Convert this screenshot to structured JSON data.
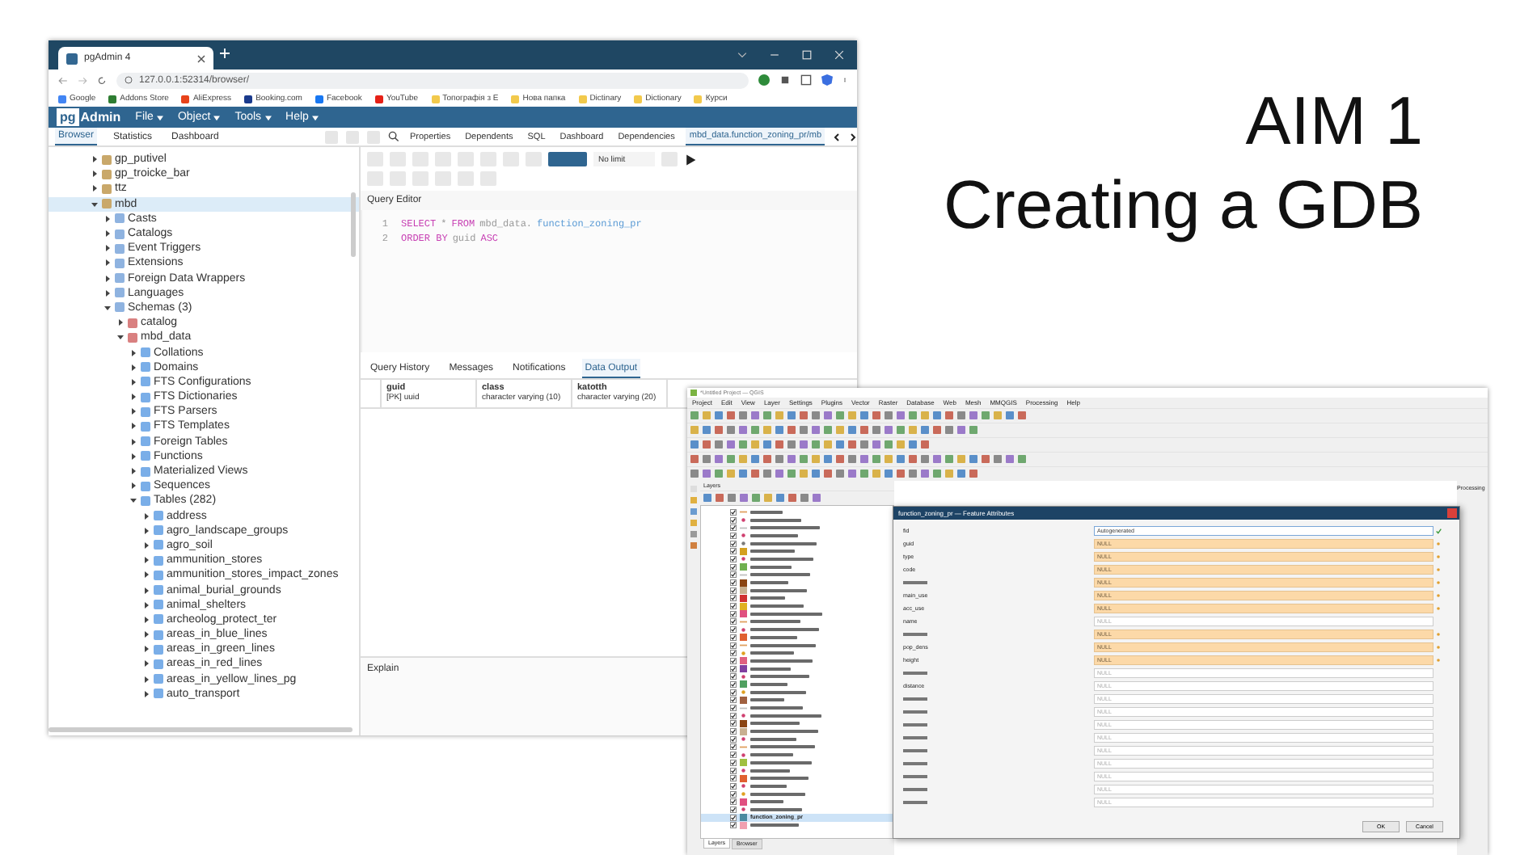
{
  "slide": {
    "title_lines": [
      "AIM 1",
      "Creating a GDB"
    ]
  },
  "pgadmin": {
    "browser_tabs": [
      {
        "label": "pgAdmin 4",
        "selected": true
      }
    ],
    "address": "127.0.0.1:52314/browser/",
    "bookmarks": [
      {
        "label": "Google",
        "color": "#4285f4"
      },
      {
        "label": "Addons Store",
        "color": "#2e7d32"
      },
      {
        "label": "AliExpress",
        "color": "#e8431a"
      },
      {
        "label": "Booking.com",
        "color": "#1a3a8c"
      },
      {
        "label": "Facebook",
        "color": "#1877f2"
      },
      {
        "label": "YouTube",
        "color": "#e62117"
      },
      {
        "label": "Топографія з Е",
        "color": "#f2c94c"
      },
      {
        "label": "Нова папка",
        "color": "#f2c94c"
      },
      {
        "label": "Dictinary",
        "color": "#f2c94c"
      },
      {
        "label": "Dictionary",
        "color": "#f2c94c"
      },
      {
        "label": "Курси",
        "color": "#f2c94c"
      }
    ],
    "logo": {
      "boxed": "pg",
      "rest": "Admin"
    },
    "menu": [
      "File",
      "Object",
      "Tools",
      "Help"
    ],
    "left_tabs": [
      {
        "label": "Browser",
        "selected": true
      },
      {
        "label": "Statistics",
        "selected": false
      },
      {
        "label": "Dashboard",
        "selected": false
      }
    ],
    "right_tabs": [
      {
        "label": "Properties",
        "selected": false
      },
      {
        "label": "Dependents",
        "selected": false
      },
      {
        "label": "SQL",
        "selected": false
      },
      {
        "label": "Dashboard",
        "selected": false
      },
      {
        "label": "Dependencies",
        "selected": false
      },
      {
        "label": "mbd_data.function_zoning_pr/mb",
        "selected": true
      }
    ],
    "tree": [
      {
        "label": "gp_putivel",
        "expanded": false,
        "selected": false
      },
      {
        "label": "gp_troicke_bar",
        "expanded": false,
        "selected": false
      },
      {
        "label": "ttz",
        "expanded": false,
        "selected": false
      },
      {
        "label": "mbd",
        "expanded": true,
        "selected": true,
        "children": [
          {
            "label": "Casts",
            "expanded": false,
            "selected": false
          },
          {
            "label": "Catalogs",
            "expanded": false,
            "selected": false
          },
          {
            "label": "Event Triggers",
            "expanded": false,
            "selected": false
          },
          {
            "label": "Extensions",
            "expanded": false,
            "selected": false
          },
          {
            "label": "Foreign Data Wrappers",
            "expanded": false,
            "selected": false
          },
          {
            "label": "Languages",
            "expanded": false,
            "selected": false
          },
          {
            "label": "Schemas (3)",
            "expanded": true,
            "selected": false,
            "children": [
              {
                "label": "catalog",
                "expanded": false,
                "selected": false
              },
              {
                "label": "mbd_data",
                "expanded": true,
                "selected": false,
                "children": [
                  {
                    "label": "Collations",
                    "expanded": false,
                    "selected": false
                  },
                  {
                    "label": "Domains",
                    "expanded": false,
                    "selected": false
                  },
                  {
                    "label": "FTS Configurations",
                    "expanded": false,
                    "selected": false
                  },
                  {
                    "label": "FTS Dictionaries",
                    "expanded": false,
                    "selected": false
                  },
                  {
                    "label": "FTS Parsers",
                    "expanded": false,
                    "selected": false
                  },
                  {
                    "label": "FTS Templates",
                    "expanded": false,
                    "selected": false
                  },
                  {
                    "label": "Foreign Tables",
                    "expanded": false,
                    "selected": false
                  },
                  {
                    "label": "Functions",
                    "expanded": false,
                    "selected": false
                  },
                  {
                    "label": "Materialized Views",
                    "expanded": false,
                    "selected": false
                  },
                  {
                    "label": "Sequences",
                    "expanded": false,
                    "selected": false
                  },
                  {
                    "label": "Tables (282)",
                    "expanded": true,
                    "selected": false,
                    "children": [
                      {
                        "label": "address",
                        "expanded": false,
                        "selected": false
                      },
                      {
                        "label": "agro_landscape_groups",
                        "expanded": false,
                        "selected": false
                      },
                      {
                        "label": "agro_soil",
                        "expanded": false,
                        "selected": false
                      },
                      {
                        "label": "ammunition_stores",
                        "expanded": false,
                        "selected": false
                      },
                      {
                        "label": "ammunition_stores_impact_zones",
                        "expanded": false,
                        "selected": false
                      },
                      {
                        "label": "animal_burial_grounds",
                        "expanded": false,
                        "selected": false
                      },
                      {
                        "label": "animal_shelters",
                        "expanded": false,
                        "selected": false
                      },
                      {
                        "label": "archeolog_protect_ter",
                        "expanded": false,
                        "selected": false
                      },
                      {
                        "label": "areas_in_blue_lines",
                        "expanded": false,
                        "selected": false
                      },
                      {
                        "label": "areas_in_green_lines",
                        "expanded": false,
                        "selected": false
                      },
                      {
                        "label": "areas_in_red_lines",
                        "expanded": false,
                        "selected": false
                      },
                      {
                        "label": "areas_in_yellow_lines_pg",
                        "expanded": false,
                        "selected": false
                      },
                      {
                        "label": "auto_transport",
                        "expanded": false,
                        "selected": false
                      }
                    ]
                  }
                ]
              }
            ]
          }
        ]
      }
    ],
    "limit": "No limit",
    "editor_title": "Query Editor",
    "code_lines": [
      {
        "number": "1",
        "tokens": [
          {
            "kind": "keyword",
            "text": "SELECT"
          },
          {
            "kind": "plain",
            "text": "*"
          },
          {
            "kind": "keyword",
            "text": "FROM"
          },
          {
            "kind": "plain",
            "text": "mbd_data."
          },
          {
            "kind": "name",
            "text": "function_zoning_pr"
          }
        ]
      },
      {
        "number": "2",
        "tokens": [
          {
            "kind": "keyword",
            "text": "ORDER BY"
          },
          {
            "kind": "plain",
            "text": "guid"
          },
          {
            "kind": "keyword",
            "text": "ASC"
          }
        ]
      }
    ],
    "result_tabs": [
      {
        "label": "Query History",
        "selected": false
      },
      {
        "label": "Messages",
        "selected": false
      },
      {
        "label": "Notifications",
        "selected": false
      },
      {
        "label": "Data Output",
        "selected": true
      }
    ],
    "columns": [
      {
        "name": "guid",
        "type": "[PK] uuid"
      },
      {
        "name": "class",
        "type": "character varying (10)"
      },
      {
        "name": "katotth",
        "type": "character varying (20)"
      }
    ],
    "explain_title": "Explain"
  },
  "qgis": {
    "title": "*Untitled Project — QGIS",
    "menu": [
      "Project",
      "Edit",
      "View",
      "Layer",
      "Settings",
      "Plugins",
      "Vector",
      "Raster",
      "Database",
      "Web",
      "Mesh",
      "MMQGIS",
      "Processing",
      "Help"
    ],
    "layers_title": "Layers",
    "layers": [
      {
        "kind": "line",
        "color": "#e0a060",
        "checked": true,
        "selected": false
      },
      {
        "kind": "point",
        "color": "#d04070",
        "checked": true,
        "selected": false
      },
      {
        "kind": "line",
        "color": "#c0c0c0",
        "checked": true,
        "selected": false
      },
      {
        "kind": "point",
        "color": "#d04070",
        "checked": true,
        "selected": false
      },
      {
        "kind": "point",
        "color": "#7a7a7a",
        "checked": true,
        "selected": false
      },
      {
        "kind": "polygon",
        "color": "#d4a020",
        "checked": true,
        "selected": false
      },
      {
        "kind": "point",
        "color": "#d04070",
        "checked": true,
        "selected": false
      },
      {
        "kind": "polygon",
        "color": "#70b050",
        "checked": true,
        "selected": false
      },
      {
        "kind": "line",
        "color": "#c0c0c0",
        "checked": true,
        "selected": false
      },
      {
        "kind": "polygon",
        "color": "#8b4513",
        "checked": true,
        "selected": false
      },
      {
        "kind": "polygon",
        "color": "#c8b090",
        "checked": true,
        "selected": false
      },
      {
        "kind": "polygon",
        "color": "#d03030",
        "checked": true,
        "selected": false
      },
      {
        "kind": "polygon",
        "color": "#e0b020",
        "checked": true,
        "selected": false
      },
      {
        "kind": "polygon",
        "color": "#e05080",
        "checked": true,
        "selected": false
      },
      {
        "kind": "line",
        "color": "#e0a060",
        "checked": true,
        "selected": false
      },
      {
        "kind": "point",
        "color": "#d04070",
        "checked": true,
        "selected": false
      },
      {
        "kind": "polygon",
        "color": "#e06030",
        "checked": true,
        "selected": false
      },
      {
        "kind": "line",
        "color": "#e0a060",
        "checked": true,
        "selected": false
      },
      {
        "kind": "point",
        "color": "#e0a020",
        "checked": true,
        "selected": false
      },
      {
        "kind": "polygon",
        "color": "#e06080",
        "checked": true,
        "selected": false
      },
      {
        "kind": "polygon",
        "color": "#8040a0",
        "checked": true,
        "selected": false
      },
      {
        "kind": "point",
        "color": "#d04070",
        "checked": true,
        "selected": false
      },
      {
        "kind": "polygon",
        "color": "#50a060",
        "checked": true,
        "selected": false
      },
      {
        "kind": "point",
        "color": "#e0a020",
        "checked": true,
        "selected": false
      },
      {
        "kind": "polygon",
        "color": "#a06040",
        "checked": true,
        "selected": false
      },
      {
        "kind": "line",
        "color": "#c0c0c0",
        "checked": true,
        "selected": false
      },
      {
        "kind": "point",
        "color": "#d04070",
        "checked": true,
        "selected": false
      },
      {
        "kind": "polygon",
        "color": "#8b4513",
        "checked": true,
        "selected": false
      },
      {
        "kind": "polygon",
        "color": "#c8b090",
        "checked": true,
        "selected": false
      },
      {
        "kind": "point",
        "color": "#d04070",
        "checked": true,
        "selected": false
      },
      {
        "kind": "line",
        "color": "#e0a060",
        "checked": true,
        "selected": false
      },
      {
        "kind": "point",
        "color": "#d04070",
        "checked": true,
        "selected": false
      },
      {
        "kind": "polygon",
        "color": "#a0c040",
        "checked": true,
        "selected": false
      },
      {
        "kind": "point",
        "color": "#d04070",
        "checked": true,
        "selected": false
      },
      {
        "kind": "polygon",
        "color": "#e06030",
        "checked": true,
        "selected": false
      },
      {
        "kind": "point",
        "color": "#d04070",
        "checked": true,
        "selected": false
      },
      {
        "kind": "point",
        "color": "#e0a020",
        "checked": true,
        "selected": false
      },
      {
        "kind": "polygon",
        "color": "#e05080",
        "checked": true,
        "selected": false
      },
      {
        "kind": "point",
        "color": "#d04070",
        "checked": true,
        "selected": false
      },
      {
        "kind": "polygon",
        "color": "#4a8aa0",
        "checked": true,
        "selected": true,
        "name": "function_zoning_pr"
      },
      {
        "kind": "polygon",
        "color": "#f0a0b0",
        "checked": true,
        "selected": false
      }
    ],
    "panel_tabs": [
      {
        "label": "Layers",
        "selected": true
      },
      {
        "label": "Browser",
        "selected": false
      }
    ],
    "processing_title": "Processing",
    "dialog": {
      "title": "function_zoning_pr — Feature Attributes",
      "fields": [
        {
          "name": "fid",
          "value": "Autogenerated",
          "required": false,
          "kind": "auto"
        },
        {
          "name": "guid",
          "value": "NULL",
          "required": true,
          "kind": "text"
        },
        {
          "name": "type",
          "value": "NULL",
          "required": true,
          "kind": "text"
        },
        {
          "name": "code",
          "value": "NULL",
          "required": true,
          "kind": "text"
        },
        {
          "value": "NULL",
          "required": true,
          "kind": "text"
        },
        {
          "name": "main_use",
          "value": "NULL",
          "required": true,
          "kind": "text"
        },
        {
          "name": "acc_use",
          "value": "NULL",
          "required": true,
          "kind": "text"
        },
        {
          "name": "name",
          "value": "NULL",
          "required": false,
          "kind": "text"
        },
        {
          "value": "NULL",
          "required": true,
          "kind": "text"
        },
        {
          "name": "pop_dens",
          "value": "NULL",
          "required": true,
          "kind": "text"
        },
        {
          "name": "height",
          "value": "NULL",
          "required": true,
          "kind": "text"
        },
        {
          "value": "NULL",
          "required": false,
          "kind": "text"
        },
        {
          "name": "distance",
          "value": "NULL",
          "required": false,
          "kind": "text"
        },
        {
          "value": "NULL",
          "required": false,
          "kind": "text"
        },
        {
          "value": "NULL",
          "required": false,
          "kind": "text"
        },
        {
          "value": "NULL",
          "required": false,
          "kind": "text"
        },
        {
          "value": "NULL",
          "required": false,
          "kind": "text"
        },
        {
          "value": "NULL",
          "required": false,
          "kind": "text"
        },
        {
          "value": "NULL",
          "required": false,
          "kind": "text"
        },
        {
          "value": "NULL",
          "required": false,
          "kind": "text"
        },
        {
          "value": "NULL",
          "required": false,
          "kind": "text"
        },
        {
          "value": "NULL",
          "required": false,
          "kind": "text"
        }
      ],
      "buttons": [
        "OK",
        "Cancel"
      ]
    }
  }
}
